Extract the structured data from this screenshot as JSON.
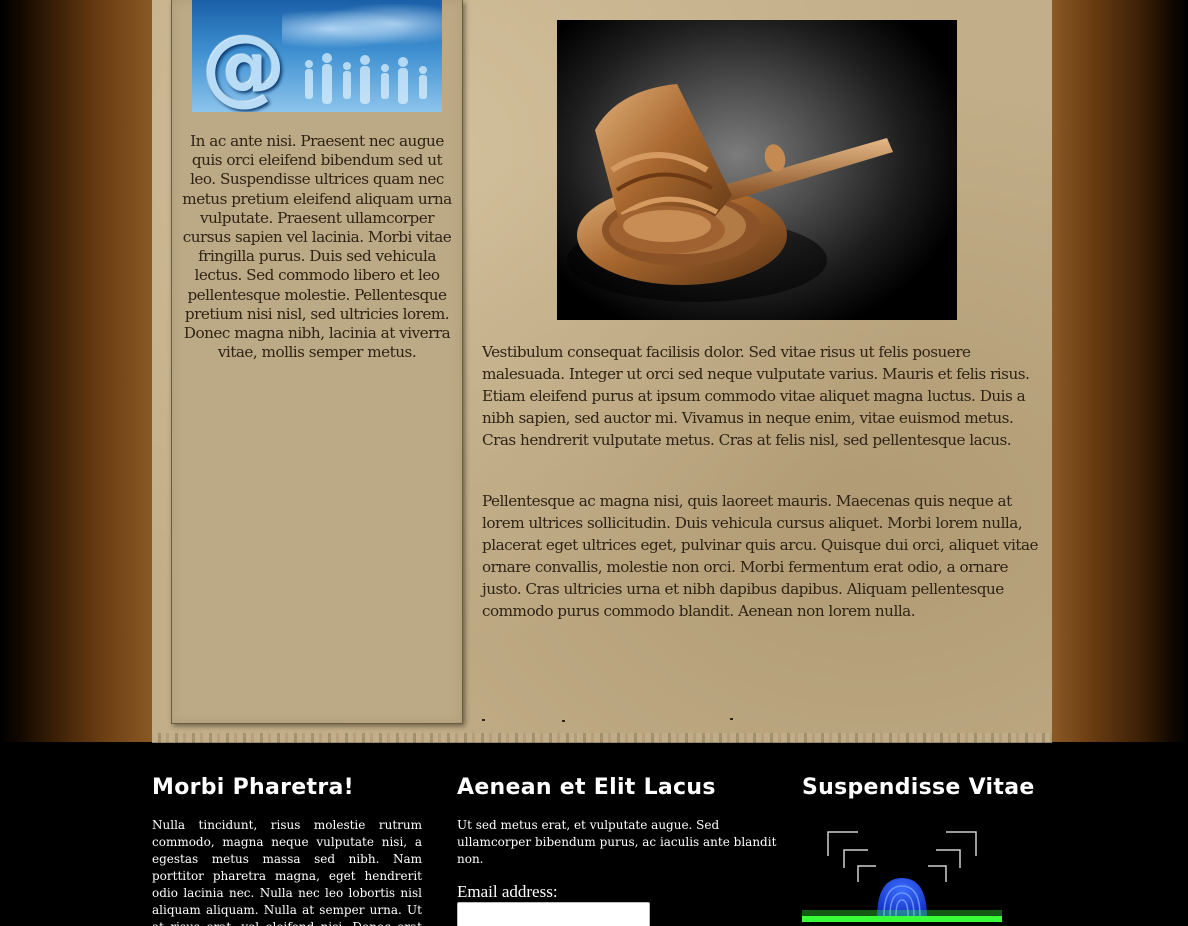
{
  "sidebar": {
    "image_alt": "at-sign world map people",
    "text": "In ac ante nisi. Praesent nec augue quis orci eleifend bibendum sed ut leo. Suspendisse ultrices quam nec metus pretium eleifend aliquam urna vulputate. Praesent ullamcorper cursus sapien vel lacinia. Morbi vitae fringilla purus. Duis sed vehicula lectus. Sed commodo libero et leo pellentesque molestie. Pellentesque pretium nisi nisl, sed ultricies lorem. Donec magna nibh, lacinia at viverra vitae, mollis semper metus."
  },
  "main": {
    "image_alt": "gavel",
    "paragraphs": [
      "Vestibulum consequat facilisis dolor. Sed vitae risus ut felis posuere malesuada. Integer ut orci sed neque vulputate varius. Mauris et felis risus. Etiam eleifend purus at ipsum commodo vitae aliquet magna luctus. Duis a nibh sapien, sed auctor mi. Vivamus in neque enim, vitae euismod metus. Cras hendrerit vulputate metus. Cras at felis nisl, sed pellentesque lacus.",
      "Pellentesque ac magna nisi, quis laoreet mauris. Maecenas quis neque at lorem ultrices sollicitudin. Duis vehicula cursus aliquet. Morbi lorem nulla, placerat eget ultrices eget, pulvinar quis arcu. Quisque dui orci, aliquet vitae ornare convallis, molestie non orci. Morbi fermentum erat odio, a ornare justo. Cras ultricies urna et nibh dapibus dapibus. Aliquam pellentesque commodo purus commodo blandit. Aenean non lorem nulla."
    ]
  },
  "footer": {
    "col1": {
      "title": "Morbi Pharetra!",
      "text": "Nulla tincidunt, risus molestie rutrum commodo, magna neque vulputate nisi, a egestas metus massa sed nibh. Nam porttitor pharetra magna, eget hendrerit odio lacinia nec. Nulla nec leo lobortis nisl aliquam aliquam. Nulla at semper urna. Ut at risus erat, vel eleifend nisi. Donec erat tempor"
    },
    "col2": {
      "title": "Aenean et Elit Lacus",
      "text": "Ut sed metus erat, et vulputate augue. Sed ullamcorper bibendum purus, ac iaculis ante blandit non.",
      "email_label": "Email address:",
      "email_value": "",
      "email_placeholder": ""
    },
    "col3": {
      "title": "Suspendisse Vitae",
      "image_alt": "fingerprint scan"
    }
  },
  "colors": {
    "parchment": "#c2ae88",
    "sidebar": "#bca985",
    "text_dark": "#2f2315",
    "footer_bg": "#000000",
    "footer_text": "#ffffff",
    "scan_green": "#39ff3a"
  }
}
